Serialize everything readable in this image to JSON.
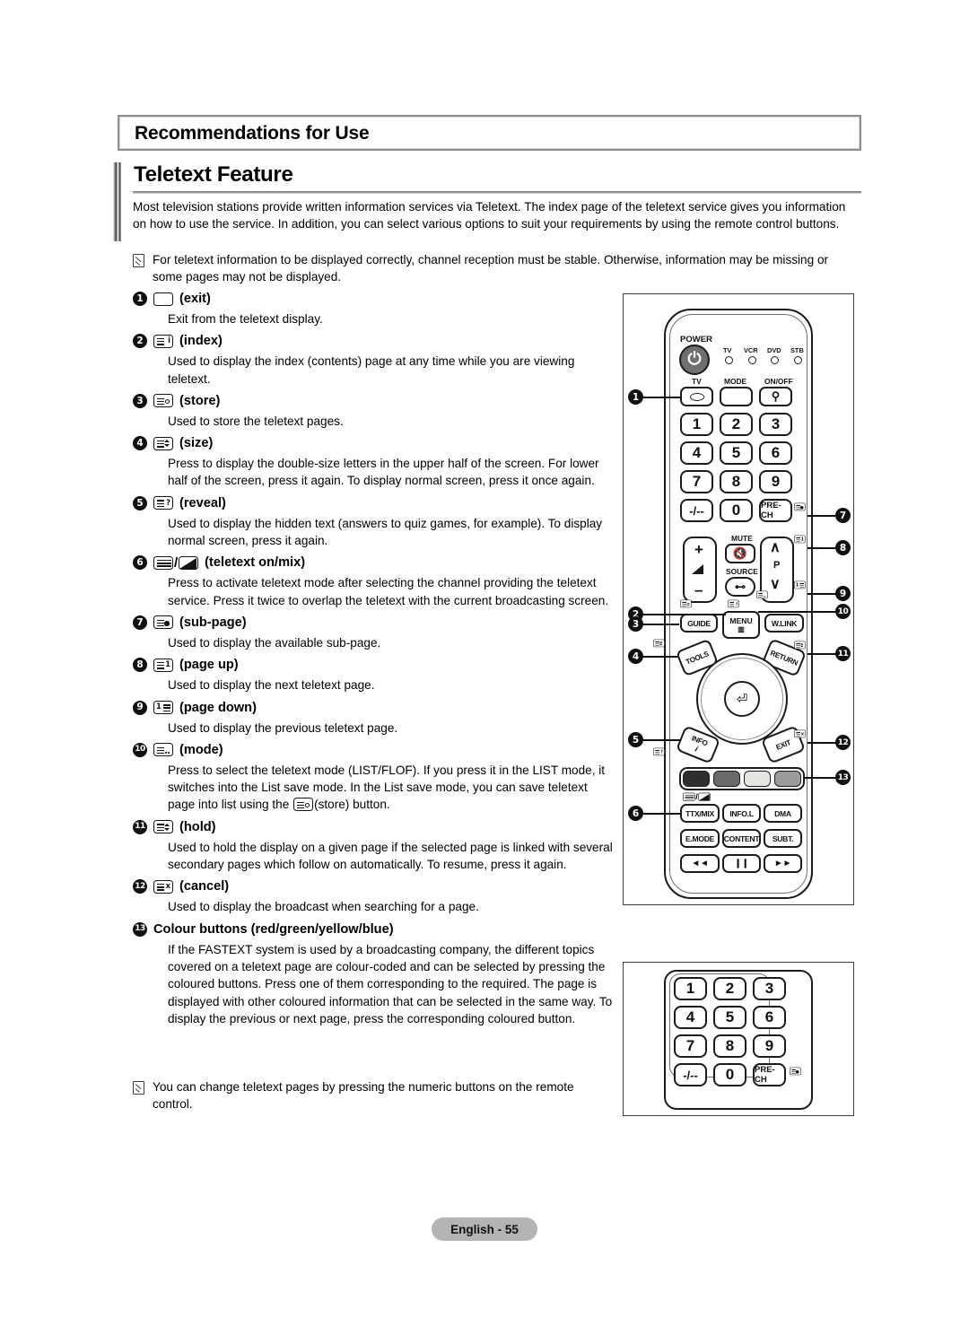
{
  "chapter": {
    "title": "Recommendations for Use"
  },
  "section": {
    "title": "Teletext Feature",
    "intro": "Most television stations provide written information services via Teletext. The index page of the teletext service gives you information on how to use the service. In addition, you can select various options to suit your requirements by using the remote control buttons."
  },
  "notes": {
    "top": "For teletext information to be displayed correctly, channel reception must be stable. Otherwise, information may be missing or some pages may not be displayed.",
    "bottom": "You can change teletext pages by pressing the numeric buttons on the remote control."
  },
  "items": [
    {
      "num": "1",
      "label": "(exit)",
      "desc": "Exit from the teletext display."
    },
    {
      "num": "2",
      "label": "(index)",
      "desc": "Used to display the index (contents) page at any time while you are viewing teletext."
    },
    {
      "num": "3",
      "label": "(store)",
      "desc": "Used to store the teletext pages."
    },
    {
      "num": "4",
      "label": "(size)",
      "desc": "Press to display the double-size letters in the upper half of the screen. For lower half of the screen, press it again. To display normal screen, press it once again."
    },
    {
      "num": "5",
      "label": "(reveal)",
      "desc": "Used to display the hidden text (answers to quiz games, for example). To display normal screen, press it again."
    },
    {
      "num": "6",
      "label": "(teletext on/mix)",
      "desc": "Press to activate teletext mode after selecting the channel providing the teletext service. Press it twice to overlap the teletext with the current broadcasting screen."
    },
    {
      "num": "7",
      "label": "(sub-page)",
      "desc": "Used to display the available sub-page."
    },
    {
      "num": "8",
      "label": "(page up)",
      "desc": "Used to display the next teletext page."
    },
    {
      "num": "9",
      "label": "(page down)",
      "desc": "Used to display the previous teletext page."
    },
    {
      "num": "10",
      "label": "(mode)",
      "desc_pre": "Press to select the teletext mode (LIST/FLOF). If you press it in the LIST mode, it switches into the List save mode. In the List save mode, you can save teletext page into list using the ",
      "desc_post": "(store) button."
    },
    {
      "num": "11",
      "label": "(hold)",
      "desc": "Used to hold the display on a given page if the selected page is linked with several secondary pages which follow on automatically. To resume, press it again."
    },
    {
      "num": "12",
      "label": "(cancel)",
      "desc": "Used to display the broadcast when searching for a page."
    },
    {
      "num": "13",
      "label": "Colour buttons (red/green/yellow/blue)",
      "desc": "If the FASTEXT system is used by a broadcasting company, the different topics covered on a teletext page are colour-coded and can be selected by pressing the coloured buttons. Press one of them corresponding to the required. The page is displayed with other coloured information that can be selected in the same way. To display the previous or next page, press the corresponding coloured button."
    }
  ],
  "remote": {
    "power_label": "POWER",
    "power_icon": "power-icon",
    "device_leds": [
      "TV",
      "VCR",
      "DVD",
      "STB"
    ],
    "row_labels": {
      "tv": "TV",
      "mode": "MODE",
      "onoff": "ON/OFF"
    },
    "keys_tv": "tv-oval-icon",
    "keys_light": "lightbulb-icon",
    "numpad": [
      "1",
      "2",
      "3",
      "4",
      "5",
      "6",
      "7",
      "8",
      "9",
      "-/--",
      "0",
      "PRE-CH"
    ],
    "volume": {
      "plus": "+",
      "minus": "–",
      "icon": "volume-icon"
    },
    "mute_label": "MUTE",
    "mute_icon": "mute-icon",
    "source_label": "SOURCE",
    "source_icon": "source-icon",
    "channel": {
      "up": "∧",
      "down": "∨",
      "label": "P"
    },
    "guide": "GUIDE",
    "menu": "MENU",
    "wlink": "W.LINK",
    "tools": "TOOLS",
    "return": "RETURN",
    "info": "INFO",
    "exit": "EXIT",
    "enter_icon": "enter-icon",
    "colour_buttons": [
      "red",
      "green",
      "yellow",
      "blue"
    ],
    "colour_swatches": [
      "#2e2e2e",
      "#6a6a6a",
      "#e6e6e2",
      "#9b9b9b"
    ],
    "media_row1": [
      "TTX/MIX",
      "INFO.L",
      "DMA"
    ],
    "media_row2": [
      "E.MODE",
      "CONTENT",
      "SUBT."
    ],
    "media_row3": [
      "◄◄",
      "❙❙",
      "►►"
    ]
  },
  "footer": {
    "page": "English - 55"
  }
}
